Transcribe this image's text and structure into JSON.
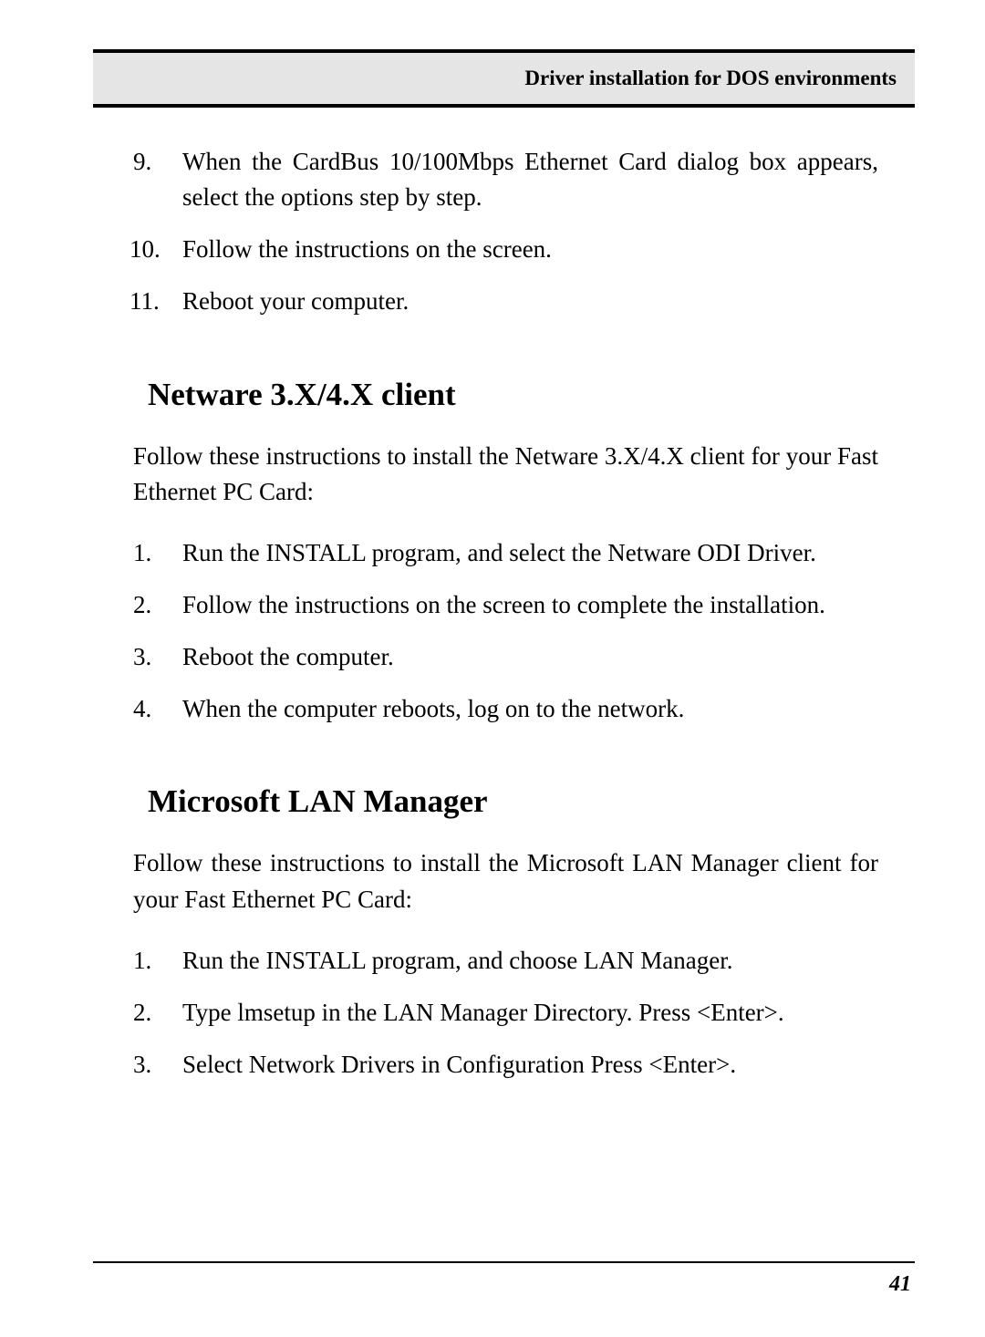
{
  "header": {
    "title": "Driver installation for DOS environments"
  },
  "section1": {
    "items": [
      {
        "num": "9.",
        "text": "When the CardBus 10/100Mbps Ethernet Card dialog box appears, select the options step by step.",
        "justify": true
      },
      {
        "num": "10.",
        "text": "Follow the instructions on the screen.",
        "justify": false
      },
      {
        "num": "11.",
        "text": "Reboot your computer.",
        "justify": false
      }
    ]
  },
  "section2": {
    "heading": "Netware 3.X/4.X client",
    "intro": "Follow these instructions to install the Netware 3.X/4.X client for your Fast Ethernet PC Card:",
    "items": [
      {
        "num": "1.",
        "text": "Run the INSTALL program, and select the Netware ODI Driver.",
        "justify": true
      },
      {
        "num": "2.",
        "text": "Follow the instructions on the screen to complete the installation.",
        "justify": false
      },
      {
        "num": "3.",
        "text": "Reboot the computer.",
        "justify": false
      },
      {
        "num": "4.",
        "text": "When the computer reboots, log on to the network.",
        "justify": false
      }
    ]
  },
  "section3": {
    "heading": "Microsoft LAN Manager",
    "intro": "Follow these instructions to install the Microsoft LAN Manager client for your Fast Ethernet PC Card:",
    "items": [
      {
        "num": "1.",
        "text": "Run the INSTALL program, and choose LAN Manager.",
        "justify": false
      },
      {
        "num": "2.",
        "text": "Type lmsetup in the LAN Manager Directory. Press <Enter>.",
        "justify": false
      },
      {
        "num": "3.",
        "text": "Select Network Drivers in Configuration  Press <Enter>.",
        "justify": false
      }
    ]
  },
  "footer": {
    "pageNumber": "41"
  }
}
